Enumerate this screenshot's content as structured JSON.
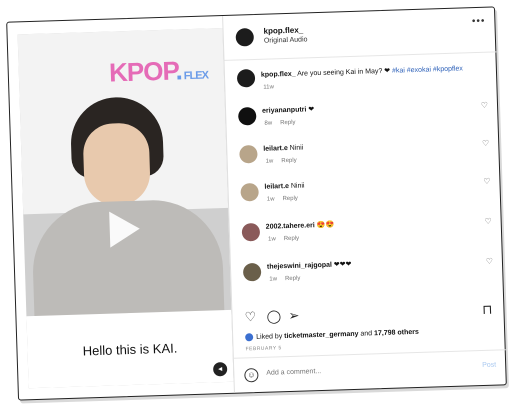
{
  "video": {
    "logo_main": "KPOP",
    "logo_dot": ".",
    "logo_sub": "FLEX",
    "caption": "Hello this is KAI."
  },
  "header": {
    "username": "kpop.flex_",
    "audio": "Original Audio",
    "more": "•••"
  },
  "post": {
    "username": "kpop.flex_",
    "text": " Are you seeing Kai in May? ❤ ",
    "tags": "#kai #exokai #kpopflex",
    "time": "11w"
  },
  "comments": [
    {
      "user": "eriyananputri",
      "text": " ❤",
      "time": "8w",
      "reply": "Reply"
    },
    {
      "user": "leilart.e",
      "text": " Ninii",
      "time": "1w",
      "reply": "Reply"
    },
    {
      "user": "leilart.e",
      "text": " Ninii",
      "time": "1w",
      "reply": "Reply"
    },
    {
      "user": "2002.tahere.eri",
      "text": " 😍😍",
      "time": "1w",
      "reply": "Reply"
    },
    {
      "user": "thejeswini_rajgopal",
      "text": " ❤❤❤",
      "time": "1w",
      "reply": "Reply"
    }
  ],
  "engagement": {
    "liked_by": "Liked by ",
    "liker": "ticketmaster_germany",
    "and": " and ",
    "others": "17,798 others",
    "date": "FEBRUARY 5"
  },
  "add_comment": {
    "placeholder": "Add a comment...",
    "post_label": "Post"
  },
  "icons": {
    "heart": "♡",
    "comment": "◯",
    "share": "➢",
    "bookmark": "⊓"
  }
}
